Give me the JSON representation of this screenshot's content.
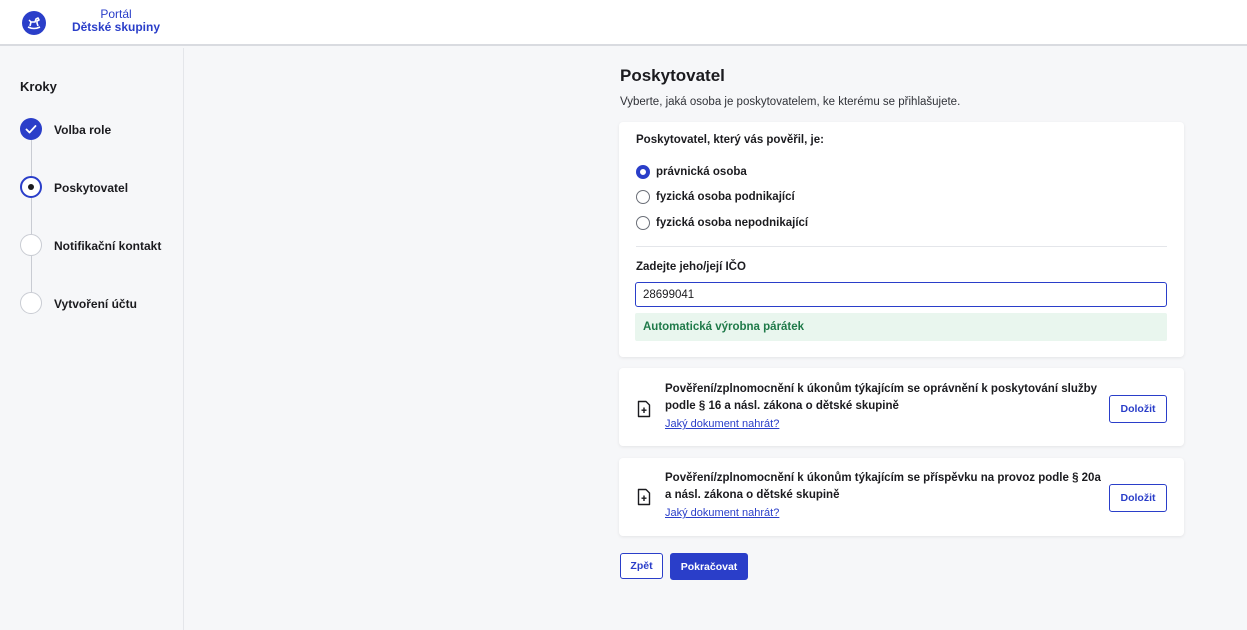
{
  "header": {
    "brand_top": "Portál",
    "brand_bottom": "Dětské skupiny"
  },
  "sidebar": {
    "title": "Kroky",
    "steps": [
      {
        "label": "Volba role",
        "state": "done"
      },
      {
        "label": "Poskytovatel",
        "state": "current"
      },
      {
        "label": "Notifikační kontakt",
        "state": "todo"
      },
      {
        "label": "Vytvoření účtu",
        "state": "todo"
      }
    ]
  },
  "main": {
    "title": "Poskytovatel",
    "subtitle": "Vyberte, jaká osoba je poskytovatelem, ke kterému se přihlašujete.",
    "provider_card": {
      "question": "Poskytovatel, který vás pověřil, je:",
      "options": [
        {
          "label": "právnická osoba",
          "checked": true
        },
        {
          "label": "fyzická osoba podnikající",
          "checked": false
        },
        {
          "label": "fyzická osoba nepodnikající",
          "checked": false
        }
      ],
      "ico_label": "Zadejte jeho/její IČO",
      "ico_value": "28699041",
      "ico_result": "Automatická výrobna párátek"
    },
    "documents": [
      {
        "text": "Pověření/zplnomocnění k úkonům týkajícím se oprávnění k poskytování služby podle § 16 a násl. zákona o dětské skupině",
        "link": "Jaký dokument nahrát?",
        "button": "Doložit"
      },
      {
        "text": "Pověření/zplnomocnění k úkonům týkajícím se příspěvku na provoz podle § 20a a násl. zákona o dětské skupině",
        "link": "Jaký dokument nahrát?",
        "button": "Doložit"
      }
    ],
    "back_button": "Zpět",
    "continue_button": "Pokračovat"
  },
  "colors": {
    "accent": "#2a3ec9",
    "success_text": "#1f7a49",
    "success_bg": "#e9f6ee",
    "background": "#f6f7f9"
  },
  "icons": [
    "rocking-horse-logo-icon",
    "check-icon",
    "document-upload-icon"
  ]
}
